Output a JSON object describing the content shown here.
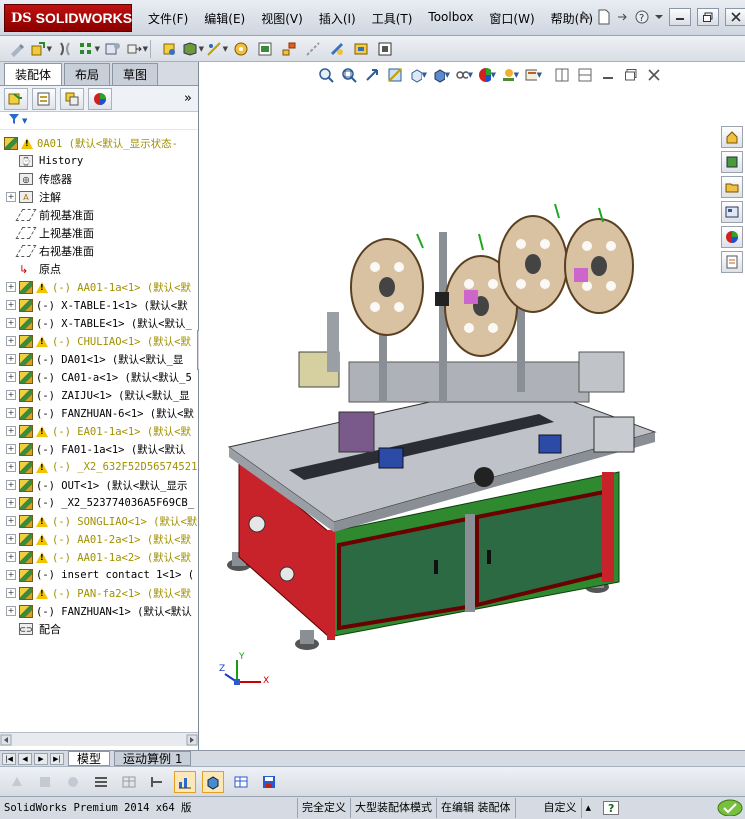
{
  "titlebar": {
    "logo_ds": "DS",
    "logo_name": "SOLIDWORKS",
    "menu": [
      "文件(F)",
      "编辑(E)",
      "视图(V)",
      "插入(I)",
      "工具(T)",
      "Toolbox",
      "窗口(W)",
      "帮助(H)"
    ]
  },
  "left_panel": {
    "tabs": [
      "装配体",
      "布局",
      "草图"
    ],
    "collapse_glyph": "»",
    "filter_glyph": "▼",
    "tree": [
      {
        "label": "0A01  (默认<默认_显示状态-",
        "kind": "root",
        "warn": true
      },
      {
        "label": "History",
        "kind": "history"
      },
      {
        "label": "传感器",
        "kind": "sensor"
      },
      {
        "label": "注解",
        "kind": "annot",
        "expand": true
      },
      {
        "label": "前视基准面",
        "kind": "plane"
      },
      {
        "label": "上视基准面",
        "kind": "plane"
      },
      {
        "label": "右视基准面",
        "kind": "plane"
      },
      {
        "label": "原点",
        "kind": "origin"
      },
      {
        "label": "(-) AA01-1a<1> (默认<默",
        "kind": "part",
        "warn": true,
        "yellow": true
      },
      {
        "label": "(-) X-TABLE-1<1> (默认<默",
        "kind": "part"
      },
      {
        "label": "(-) X-TABLE<1> (默认<默认_",
        "kind": "part"
      },
      {
        "label": "(-) CHULIAO<1> (默认<默",
        "kind": "part",
        "warn": true,
        "yellow": true
      },
      {
        "label": "(-) DA01<1> (默认<默认_显",
        "kind": "part"
      },
      {
        "label": "(-) CA01-a<1> (默认<默认_5",
        "kind": "part"
      },
      {
        "label": "(-) ZAIJU<1> (默认<默认_显",
        "kind": "part"
      },
      {
        "label": "(-) FANZHUAN-6<1> (默认<默",
        "kind": "part"
      },
      {
        "label": "(-) EA01-1a<1> (默认<默",
        "kind": "part",
        "warn": true,
        "yellow": true
      },
      {
        "label": "(-) FA01-1a<1> (默认<默认",
        "kind": "part"
      },
      {
        "label": "(-) _X2_632F52D56574521",
        "kind": "part",
        "warn": true,
        "yellow": true
      },
      {
        "label": "(-) OUT<1> (默认<默认_显示",
        "kind": "part"
      },
      {
        "label": "(-) _X2_523774036A5F69CB_",
        "kind": "part"
      },
      {
        "label": "(-) SONGLIAO<1> (默认<默",
        "kind": "part",
        "warn": true,
        "yellow": true
      },
      {
        "label": "(-) AA01-2a<1> (默认<默",
        "kind": "part",
        "warn": true,
        "yellow": true
      },
      {
        "label": "(-) AA01-1a<2> (默认<默",
        "kind": "part",
        "warn": true,
        "yellow": true
      },
      {
        "label": "(-) insert contact 1<1> (",
        "kind": "part"
      },
      {
        "label": "(-) PAN-fa2<1> (默认<默",
        "kind": "part",
        "warn": true,
        "yellow": true
      },
      {
        "label": "(-) FANZHUAN<1> (默认<默认",
        "kind": "part"
      },
      {
        "label": "配合",
        "kind": "mates"
      }
    ]
  },
  "model_tabs": [
    "模型",
    "运动算例 1"
  ],
  "status": {
    "product": "SolidWorks Premium 2014 x64 版",
    "defined": "完全定义",
    "mode": "大型装配体模式",
    "editing": "在编辑 装配体",
    "custom": "自定义",
    "arrow": "▴",
    "help": "?"
  },
  "triad": {
    "x": "X",
    "y": "Y",
    "z": "Z"
  }
}
